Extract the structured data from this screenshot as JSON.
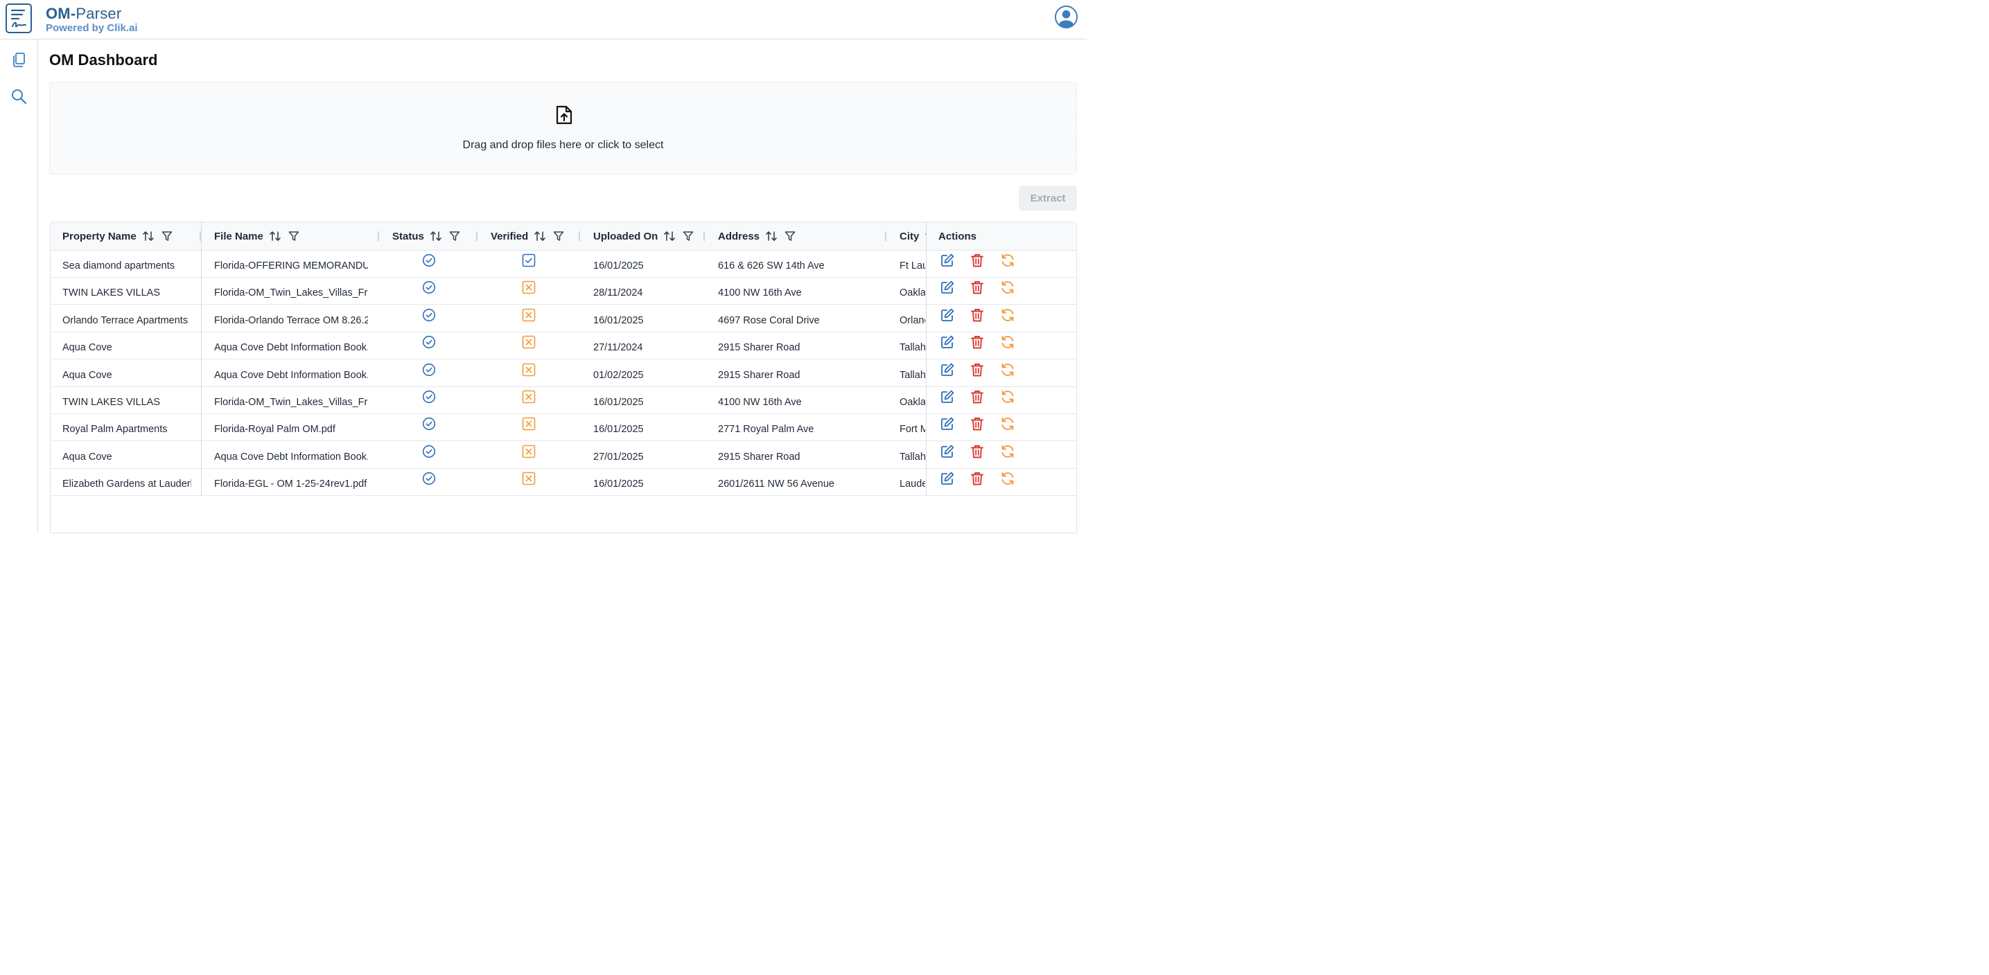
{
  "header": {
    "brand_prefix": "OM-",
    "brand_name": "Parser",
    "brand_sub": "Powered by Clik.ai"
  },
  "sidebar": {
    "items": [
      {
        "name": "documents-icon"
      },
      {
        "name": "search-icon"
      }
    ]
  },
  "page": {
    "title": "OM Dashboard"
  },
  "dropzone": {
    "text": "Drag and drop files here or click to select"
  },
  "extract_button": "Extract",
  "colors": {
    "brand": "#2b5f8f",
    "brand_light": "#5b8fc4",
    "status_blue": "#2f6fb7",
    "unverified_orange": "#f29a38",
    "delete_red": "#d93a34",
    "reload_orange": "#f29a38"
  },
  "table": {
    "columns": [
      "Property Name",
      "File Name",
      "Status",
      "Verified",
      "Uploaded On",
      "Address",
      "City",
      "Actions"
    ],
    "rows": [
      {
        "property": "Sea diamond apartments",
        "file": "Florida-OFFERING MEMORANDUM",
        "status": "done",
        "verified": true,
        "uploaded": "16/01/2025",
        "address": "616 & 626 SW 14th Ave",
        "city": "Ft Lau"
      },
      {
        "property": "TWIN LAKES VILLAS",
        "file": "Florida-OM_Twin_Lakes_Villas_Fra",
        "status": "done",
        "verified": false,
        "uploaded": "28/11/2024",
        "address": "4100 NW 16th Ave",
        "city": "Oakla"
      },
      {
        "property": "Orlando Terrace Apartments",
        "file": "Florida-Orlando Terrace OM 8.26.2",
        "status": "done",
        "verified": false,
        "uploaded": "16/01/2025",
        "address": "4697 Rose Coral Drive",
        "city": "Orland"
      },
      {
        "property": "Aqua Cove",
        "file": "Aqua Cove Debt Information Book.",
        "status": "done",
        "verified": false,
        "uploaded": "27/11/2024",
        "address": "2915 Sharer Road",
        "city": "Tallah"
      },
      {
        "property": "Aqua Cove",
        "file": "Aqua Cove Debt Information Book.",
        "status": "done",
        "verified": false,
        "uploaded": "01/02/2025",
        "address": "2915 Sharer Road",
        "city": "Tallah"
      },
      {
        "property": "TWIN LAKES VILLAS",
        "file": "Florida-OM_Twin_Lakes_Villas_Fra",
        "status": "done",
        "verified": false,
        "uploaded": "16/01/2025",
        "address": "4100 NW 16th Ave",
        "city": "Oakla"
      },
      {
        "property": "Royal Palm Apartments",
        "file": "Florida-Royal Palm OM.pdf",
        "status": "done",
        "verified": false,
        "uploaded": "16/01/2025",
        "address": "2771 Royal Palm Ave",
        "city": "Fort M"
      },
      {
        "property": "Aqua Cove",
        "file": "Aqua Cove Debt Information Book.",
        "status": "done",
        "verified": false,
        "uploaded": "27/01/2025",
        "address": "2915 Sharer Road",
        "city": "Tallah"
      },
      {
        "property": "Elizabeth Gardens at Lauderl",
        "file": "Florida-EGL - OM 1-25-24rev1.pdf",
        "status": "done",
        "verified": false,
        "uploaded": "16/01/2025",
        "address": "2601/2611 NW 56 Avenue",
        "city": "Laude"
      }
    ]
  }
}
